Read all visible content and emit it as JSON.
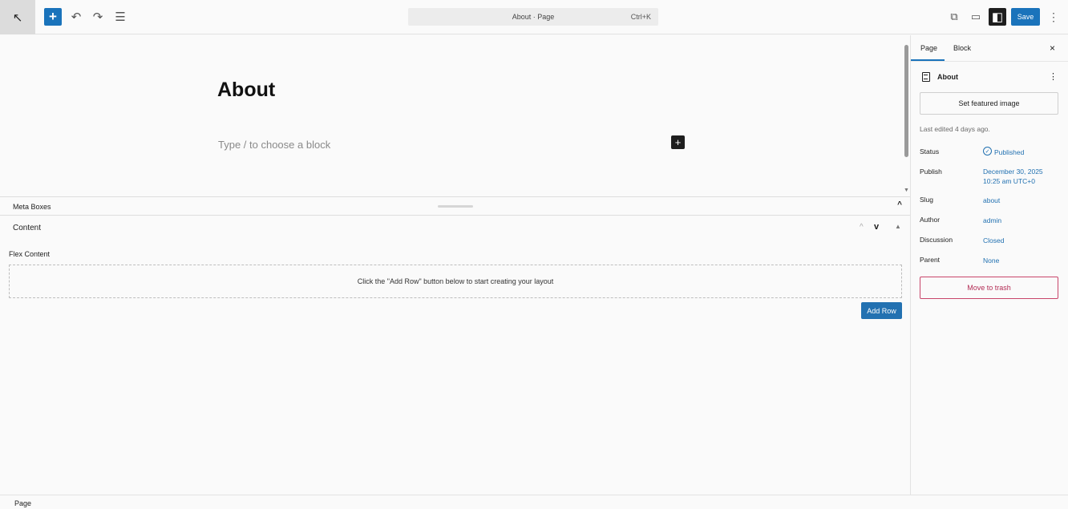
{
  "toolbar": {
    "wp_logo_icon": "arrow-up-left-icon",
    "add_icon": "+",
    "undo_icon": "↶",
    "redo_icon": "↷",
    "listview_icon": "☰",
    "command_title": "About · Page",
    "command_shortcut": "Ctrl+K",
    "view_icon": "⧉",
    "preview_icon": "▭",
    "settings_icon": "◧",
    "save_label": "Save",
    "options_icon": "⋮",
    "accent_color": "#1a73bb"
  },
  "editor": {
    "title": "About",
    "placeholder": "Type / to choose a block",
    "inline_add_icon": "+"
  },
  "meta_boxes": {
    "title": "Meta Boxes",
    "collapse_icon": "^",
    "content_box": {
      "title": "Content",
      "move_up_icon": "^",
      "move_down_icon": "v",
      "toggle_icon": "▲",
      "field_label": "Flex Content",
      "empty_message": "Click the \"Add Row\" button below to start creating your layout",
      "add_row_label": "Add Row"
    }
  },
  "footer": {
    "breadcrumb": "Page"
  },
  "sidebar": {
    "tabs": [
      {
        "label": "Page",
        "active": true
      },
      {
        "label": "Block",
        "active": false
      }
    ],
    "close_icon": "×",
    "document_title": "About",
    "more_icon": "⋮",
    "featured_image_label": "Set featured image",
    "last_edited": "Last edited 4 days ago.",
    "rows": {
      "status": {
        "label": "Status",
        "value": "Published"
      },
      "publish": {
        "label": "Publish",
        "value_line1": "December 30, 2025",
        "value_line2": "10:25 am UTC+0"
      },
      "slug": {
        "label": "Slug",
        "value": "about"
      },
      "author": {
        "label": "Author",
        "value": "admin"
      },
      "discussion": {
        "label": "Discussion",
        "value": "Closed"
      },
      "parent": {
        "label": "Parent",
        "value": "None"
      }
    },
    "trash_label": "Move to trash",
    "trash_color": "#b32d55",
    "link_color": "#2271b1"
  }
}
